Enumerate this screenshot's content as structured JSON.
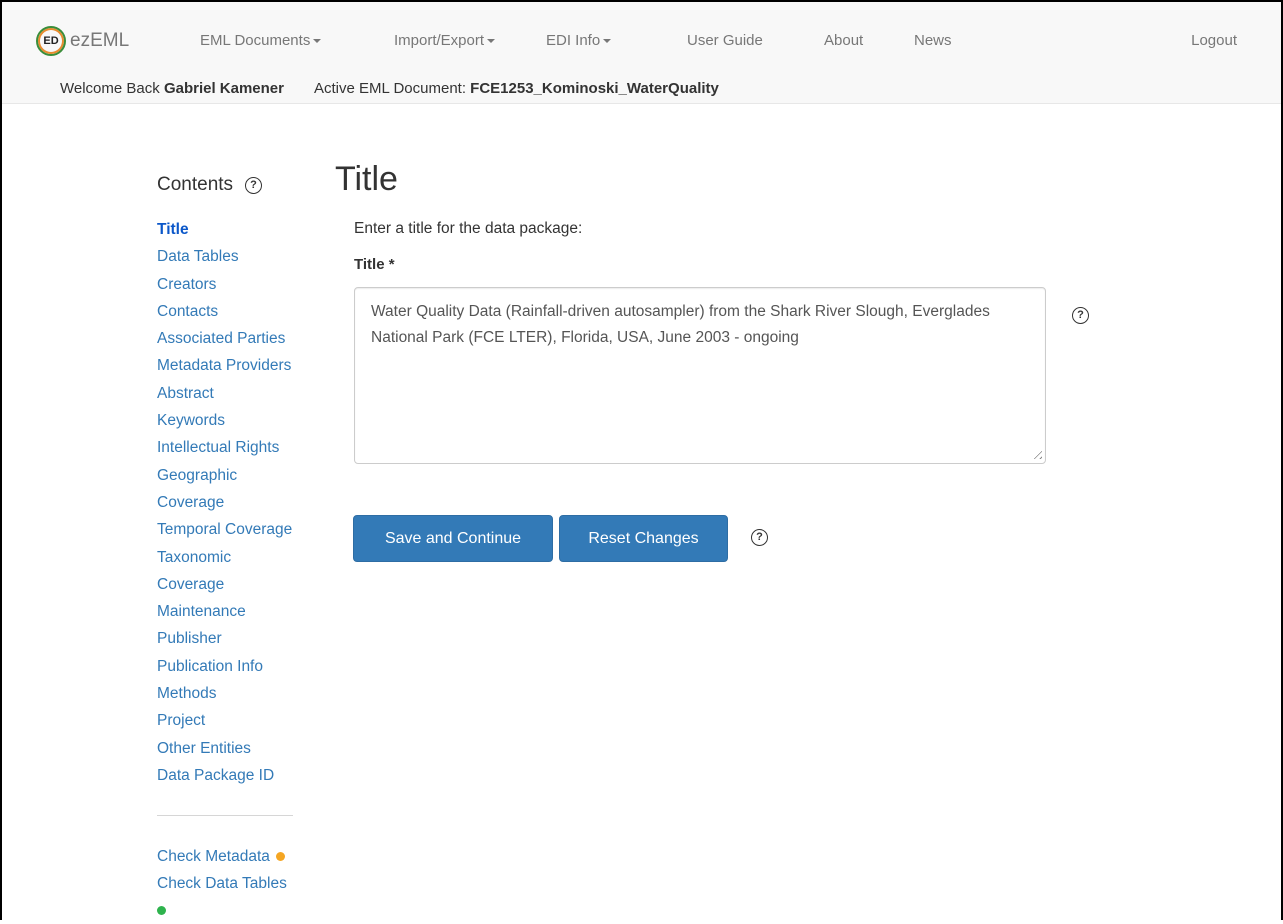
{
  "brand": {
    "logo_text": "ED",
    "name": "ezEML"
  },
  "nav": {
    "items": [
      {
        "label": "EML Documents",
        "dropdown": true
      },
      {
        "label": "Import/Export",
        "dropdown": true
      },
      {
        "label": "EDI Info",
        "dropdown": true
      },
      {
        "label": "User Guide",
        "dropdown": false
      },
      {
        "label": "About",
        "dropdown": false
      },
      {
        "label": "News",
        "dropdown": false
      }
    ],
    "logout": "Logout"
  },
  "welcome": {
    "prefix": "Welcome Back",
    "user": "Gabriel Kamener",
    "doc_prefix": "Active EML Document:",
    "doc_name": "FCE1253_Kominoski_WaterQuality"
  },
  "sidebar": {
    "heading": "Contents",
    "help": "?",
    "items": [
      "Title",
      "Data Tables",
      "Creators",
      "Contacts",
      "Associated Parties",
      "Metadata Providers",
      "Abstract",
      "Keywords",
      "Intellectual Rights",
      "Geographic",
      "Coverage",
      "Temporal Coverage",
      "Taxonomic",
      "Coverage",
      "Maintenance",
      "Publisher",
      "Publication Info",
      "Methods",
      "Project",
      "Other Entities",
      "Data Package ID"
    ],
    "active_index": 0,
    "checks": {
      "metadata": "Check Metadata",
      "data_tables": "Check Data Tables"
    }
  },
  "main": {
    "title": "Title",
    "prompt": "Enter a title for the data package:",
    "field_label": "Title *",
    "field_value": "Water Quality Data (Rainfall-driven autosampler) from the Shark River Slough, Everglades National Park (FCE LTER), Florida, USA, June 2003 - ongoing",
    "help": "?",
    "save_label": "Save and Continue",
    "reset_label": "Reset Changes"
  },
  "colors": {
    "link": "#337ab7",
    "link_active": "#0b57c9",
    "button": "#337ab7",
    "metadata_status": "#f5a623",
    "data_tables_status": "#2eb34d",
    "navbar_bg": "#f8f8f8"
  }
}
